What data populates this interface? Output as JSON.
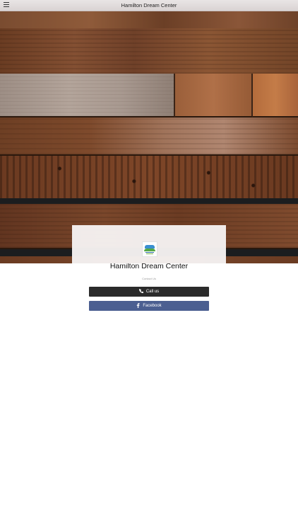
{
  "header": {
    "title": "Hamilton Dream Center",
    "menu_icon": "hamburger-menu-icon"
  },
  "card": {
    "org_name": "Hamilton Dream Center",
    "contact_label": "Contact Us"
  },
  "actions": {
    "call_label": "Call us",
    "call_icon": "phone-icon",
    "facebook_label": "Facebook",
    "facebook_icon": "facebook-icon"
  },
  "colors": {
    "call_button": "#2b2b2b",
    "facebook_button": "#4b5f91"
  }
}
